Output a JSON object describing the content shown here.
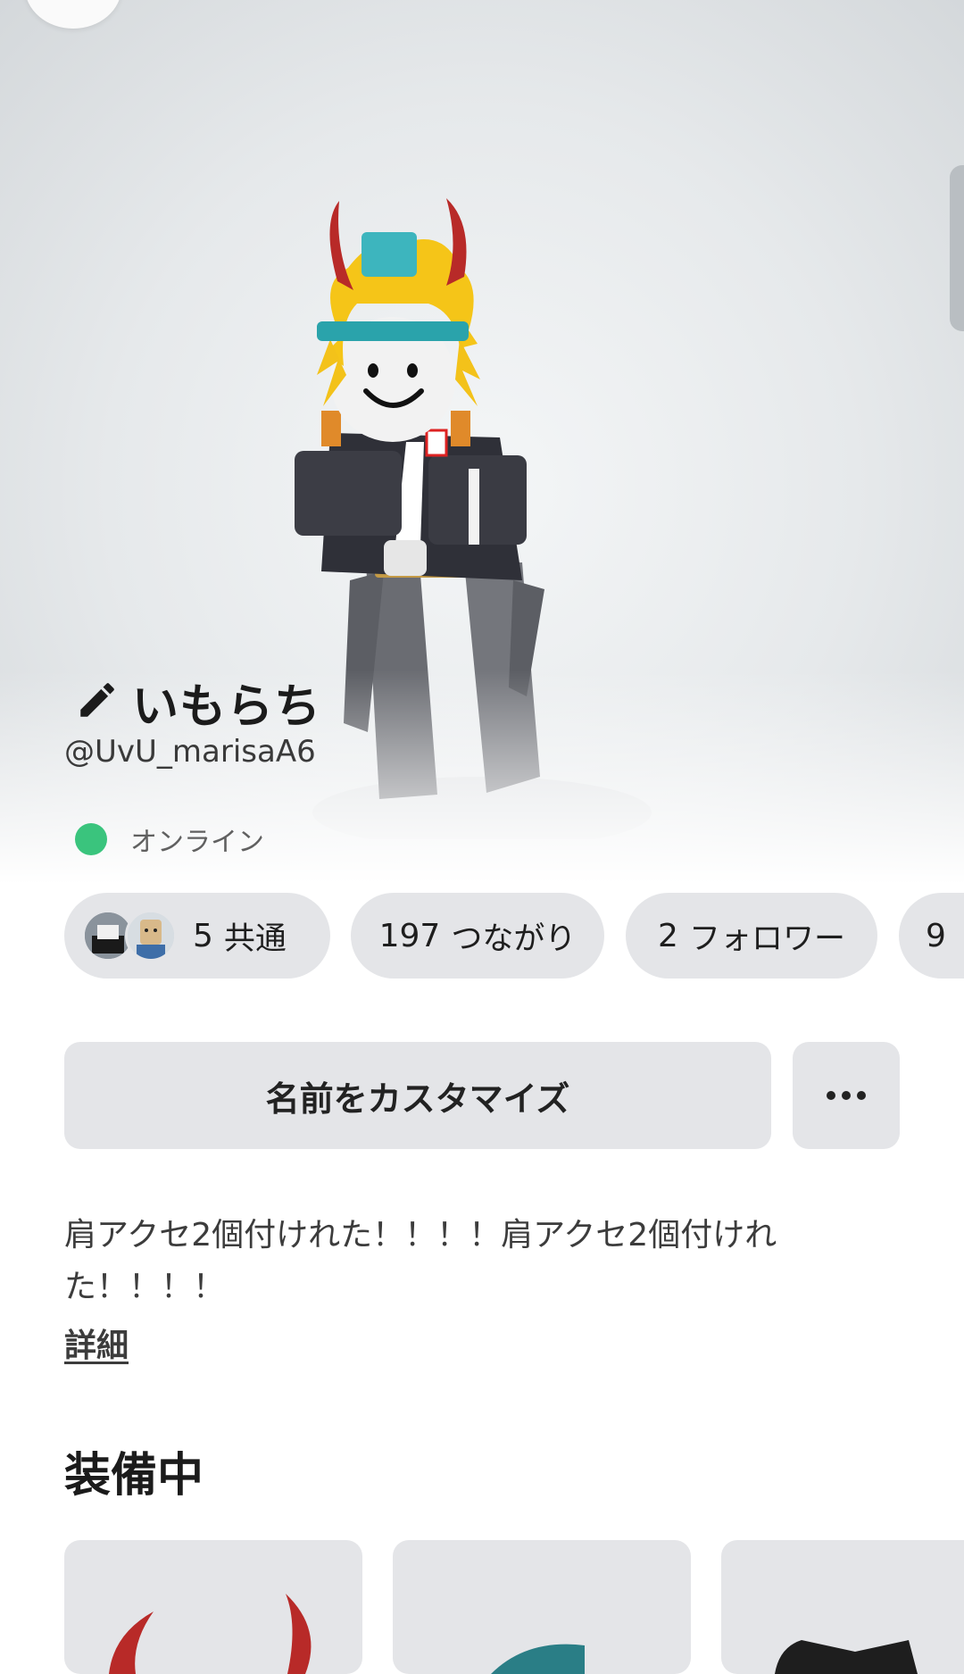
{
  "profile": {
    "display_name": "いもらち",
    "username": "@UvU_marisaA6",
    "presence": "オンライン"
  },
  "stats": {
    "mutual": {
      "count": "5",
      "label": "共通"
    },
    "connections": {
      "count": "197",
      "label": "つながり"
    },
    "followers": {
      "count": "2",
      "label": "フォロワー"
    },
    "following_partial": {
      "count": "9"
    }
  },
  "actions": {
    "customize_label": "名前をカスタマイズ",
    "more_label": "..."
  },
  "bio": {
    "text": "肩アクセ2個付けれた！！！！肩アクセ2個付けれた！！！！",
    "more_link": "詳細"
  },
  "equipped": {
    "title": "装備中"
  },
  "colors": {
    "presence_online": "#3ac47d",
    "pill_bg": "#e4e5e8"
  }
}
